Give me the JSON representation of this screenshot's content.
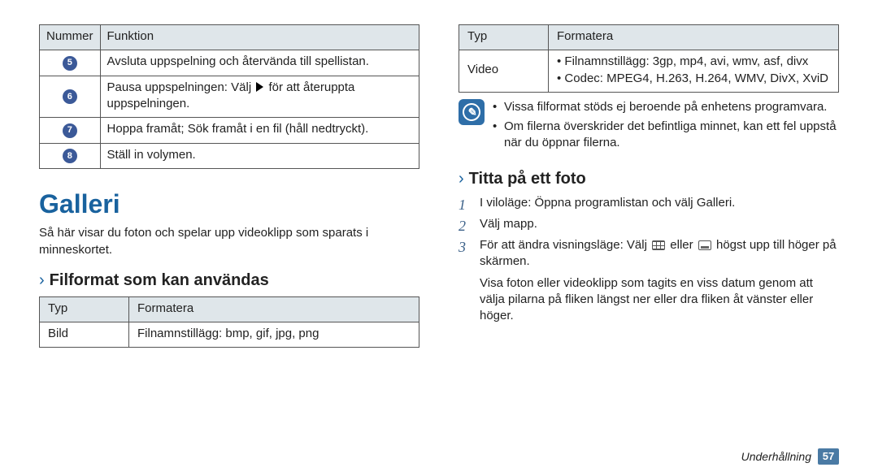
{
  "left_table": {
    "headers": [
      "Nummer",
      "Funktion"
    ],
    "rows": [
      {
        "num": "5",
        "text": "Avsluta uppspelning och återvända till spellistan."
      },
      {
        "num": "6",
        "text_before": "Pausa uppspelningen: Välj ",
        "text_after": " för att återuppta uppspelningen.",
        "has_play_icon": true
      },
      {
        "num": "7",
        "text": "Hoppa framåt; Sök framåt i en fil (håll nedtryckt)."
      },
      {
        "num": "8",
        "text": "Ställ in volymen."
      }
    ]
  },
  "section_title": "Galleri",
  "section_intro": "Så här visar du foton och spelar upp videoklipp som sparats i minneskortet.",
  "subhead_left": "Filformat som kan användas",
  "fmt_table_left": {
    "headers": [
      "Typ",
      "Formatera"
    ],
    "rows": [
      {
        "typ": "Bild",
        "formatera": "Filnamnstillägg: bmp, gif, jpg, png"
      }
    ]
  },
  "fmt_table_right": {
    "headers": [
      "Typ",
      "Formatera"
    ],
    "rows": [
      {
        "typ": "Video",
        "bullets": [
          "Filnamnstillägg: 3gp, mp4, avi, wmv, asf, divx",
          "Codec: MPEG4, H.263, H.264, WMV, DivX, XviD"
        ]
      }
    ]
  },
  "note": {
    "bullets": [
      "Vissa filformat stöds ej beroende på enhetens programvara.",
      "Om filerna överskrider det befintliga minnet, kan ett fel uppstå när du öppnar filerna."
    ]
  },
  "subhead_right": "Titta på ett foto",
  "steps": {
    "s1_before": "I viloläge: Öppna programlistan och välj ",
    "s1_app": "Galleri",
    "s1_after": ".",
    "s2": "Välj mapp.",
    "s3_before": "För att ändra visningsläge: Välj ",
    "s3_mid": " eller ",
    "s3_after": " högst upp till höger på skärmen.",
    "s3_extra": "Visa foton eller videoklipp som tagits en viss datum genom att välja pilarna på fliken längst ner eller dra fliken åt vänster eller höger."
  },
  "footer": {
    "section": "Underhållning",
    "page": "57"
  }
}
